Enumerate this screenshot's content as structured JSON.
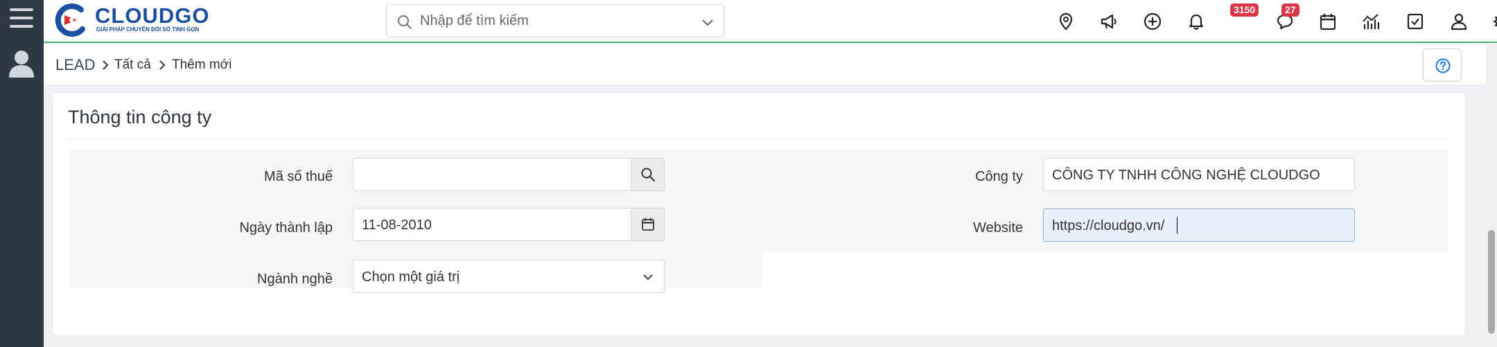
{
  "header": {
    "logo_text": "CLOUDGO",
    "logo_tagline": "GIẢI PHÁP CHUYỂN ĐỔI SỐ TINH GỌN",
    "search_placeholder": "Nhập để tìm kiếm",
    "icons": [
      "map-pin-icon",
      "megaphone-icon",
      "plus-circle-icon",
      "bell-icon",
      "chat-icon",
      "calendar-icon",
      "chart-icon",
      "checkbox-icon",
      "user-icon",
      "gear-icon"
    ],
    "notification_count": "3150",
    "message_count": "27"
  },
  "breadcrumb": {
    "module": "LEAD",
    "level1": "Tất cả",
    "level2": "Thêm mới"
  },
  "section": {
    "title": "Thông tin công ty",
    "fields": {
      "tax_code": {
        "label": "Mã số thuế",
        "value": ""
      },
      "founded_date": {
        "label": "Ngày thành lập",
        "value": "11-08-2010"
      },
      "industry": {
        "label": "Ngành nghề",
        "value": "Chọn một giá trị"
      },
      "company": {
        "label": "Công ty",
        "value": "CÔNG TY TNHH CÔNG NGHỆ CLOUDGO"
      },
      "website": {
        "label": "Website",
        "value": "https://cloudgo.vn/"
      }
    }
  },
  "colors": {
    "sidebar": "#2d3a45",
    "brand": "#1c4fa0",
    "brand_red": "#e0312d",
    "header_accent": "#4caf7a",
    "badge": "#dc3545",
    "active_field": "#e8f0fe"
  }
}
